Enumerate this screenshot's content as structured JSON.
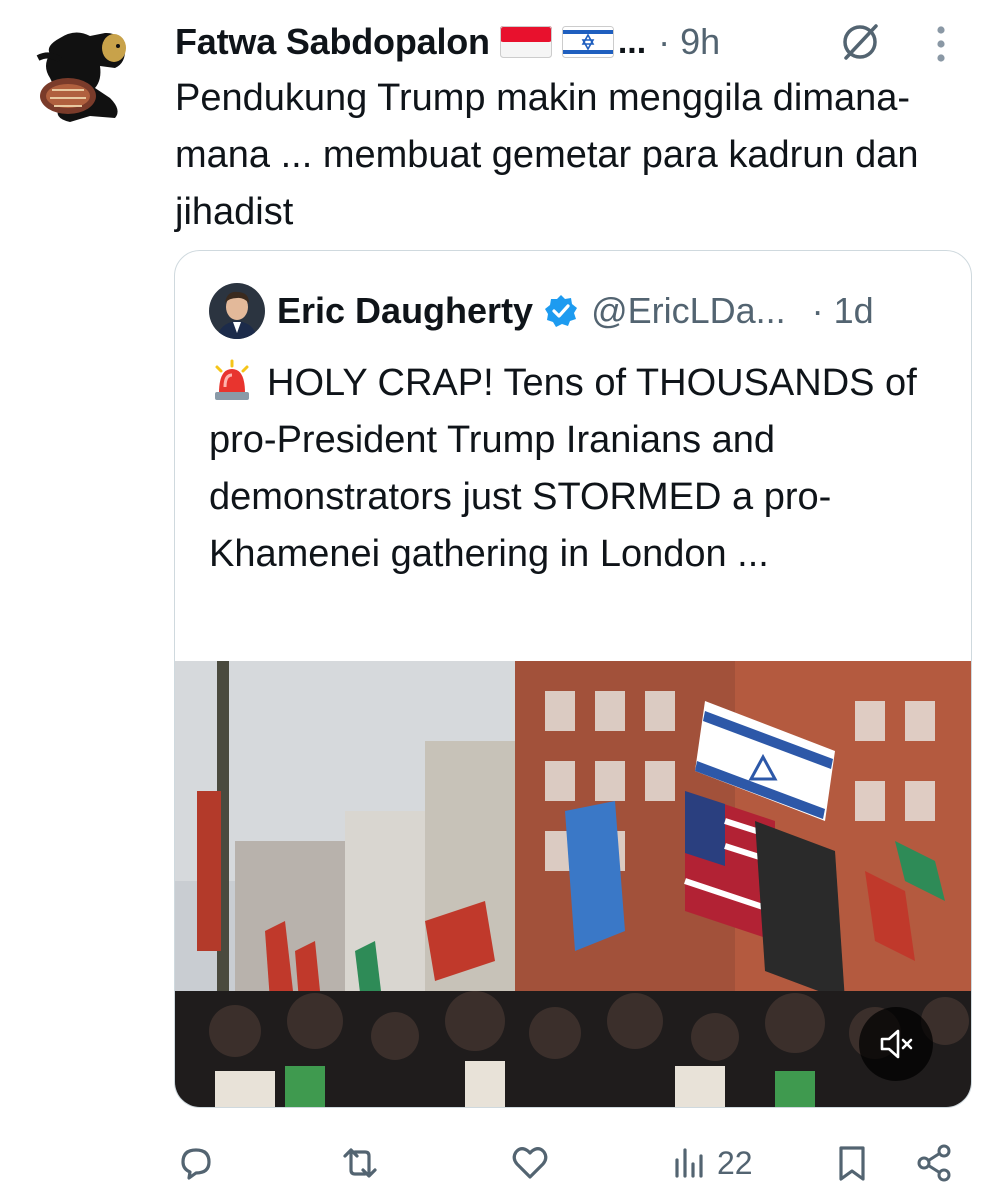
{
  "post": {
    "author_name": "Fatwa Sabdopalon",
    "truncation": "...",
    "time": "· 9h",
    "text": "Pendukung Trump makin menggila dimana-mana ... membuat gemetar para kadrun dan jihadist",
    "flags": [
      "indonesia-flag",
      "israel-flag"
    ]
  },
  "quoted": {
    "name": "Eric Daugherty",
    "handle": "@EricLDa...",
    "time": "· 1d",
    "text": "HOLY CRAP! Tens of THOUSANDS of pro-President Trump Iranians and demonstrators just STORMED a pro-Khamenei gathering in London ...",
    "media": "video-crowd-with-flags"
  },
  "actions": {
    "views": "22",
    "icons": [
      "reply-icon",
      "repost-icon",
      "like-icon",
      "views-icon",
      "bookmark-icon",
      "share-icon"
    ]
  },
  "colors": {
    "text": "#0f1419",
    "muted": "#536471",
    "verified": "#1d9bf0",
    "border": "#cfd9de"
  }
}
